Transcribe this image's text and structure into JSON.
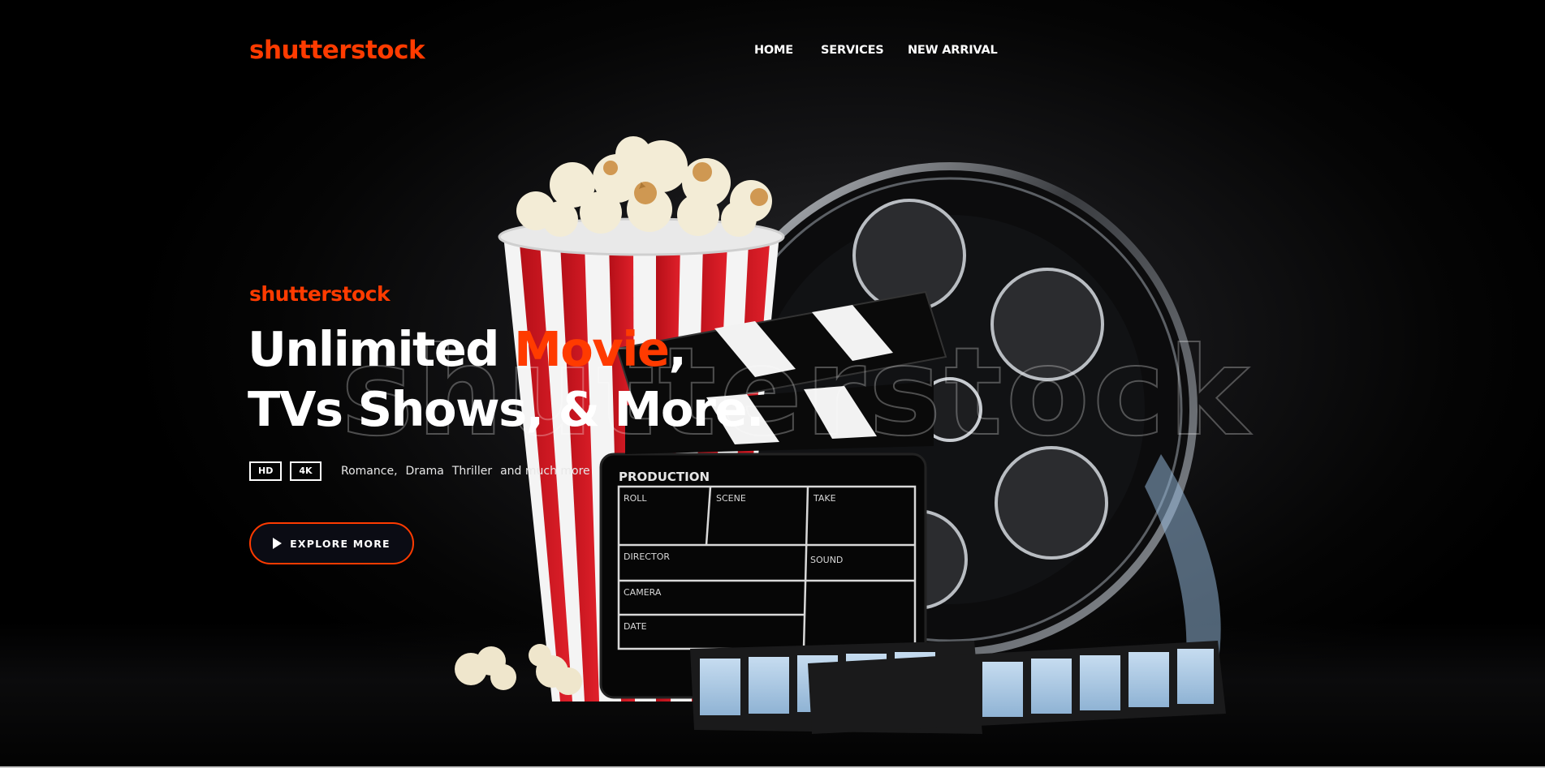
{
  "header": {
    "logo": "shutterstock",
    "nav": [
      {
        "label": "HOME"
      },
      {
        "label": "SERVICES"
      },
      {
        "label": "NEW ARRIVAL"
      }
    ]
  },
  "hero": {
    "kicker": "shutterstock",
    "headline_part1": "Unlimited ",
    "headline_accent": "Movie",
    "headline_part2": ",",
    "headline_line2": "TVs Shows, & More.",
    "badges": [
      "HD",
      "4K"
    ],
    "genres": [
      "Romance,",
      "Drama",
      "Thriller",
      "and much more"
    ],
    "cta_label": "EXPLORE MORE",
    "watermark": "shutterstock",
    "clapper": {
      "title": "PRODUCTION",
      "fields": [
        "ROLL",
        "SCENE",
        "TAKE",
        "DIRECTOR",
        "SOUND",
        "CAMERA",
        "DATE"
      ]
    }
  },
  "colors": {
    "accent": "#ff3b00",
    "background": "#000000",
    "text": "#ffffff"
  },
  "icons": {
    "cta": "play-icon"
  }
}
